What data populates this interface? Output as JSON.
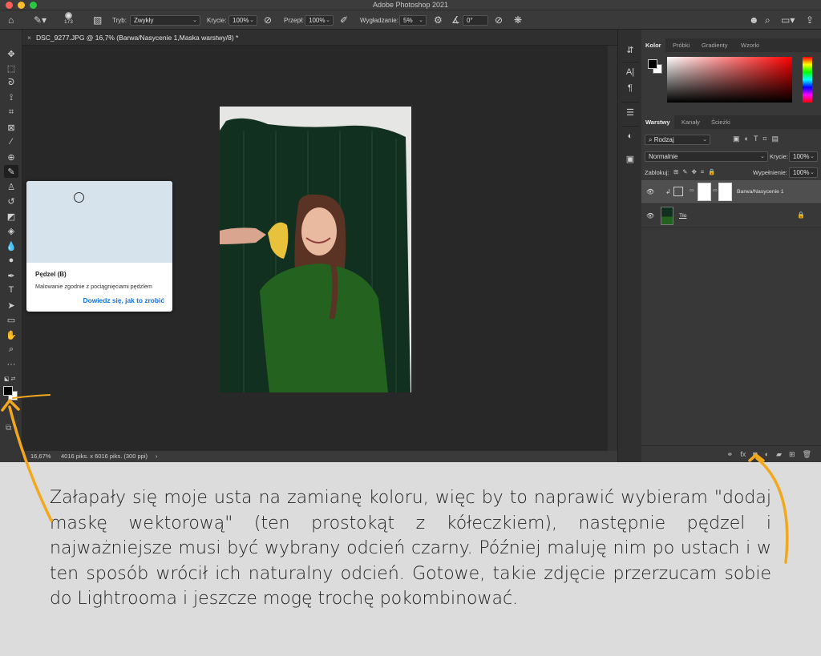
{
  "window": {
    "title": "Adobe Photoshop 2021"
  },
  "options_bar": {
    "brush_size": "173",
    "mode_label": "Tryb:",
    "mode_value": "Zwykły",
    "opacity_label": "Krycie:",
    "opacity_value": "100%",
    "flow_label": "Przepł:",
    "flow_value": "100%",
    "smoothing_label": "Wygładzanie:",
    "smoothing_value": "5%",
    "angle_value": "0°"
  },
  "document": {
    "tab_title": "DSC_9277.JPG @ 16,7% (Barwa/Nasycenie 1,Maska warstwy/8) *",
    "zoom": "16,67%",
    "dimensions": "4016 piks. x 6016 piks. (300 ppi)",
    "status_arrow": "›"
  },
  "tooltip": {
    "title": "Pędzel (B)",
    "description": "Malowanie zgodnie z pociągnięciami pędzlem",
    "link": "Dowiedz się, jak to zrobić"
  },
  "color_panel": {
    "tabs": [
      "Kolor",
      "Próbki",
      "Gradienty",
      "Wzorki"
    ],
    "foreground": "#000000",
    "background": "#ffffff"
  },
  "layers_panel": {
    "tabs": [
      "Warstwy",
      "Kanały",
      "Ścieżki"
    ],
    "filter_label": "Rodzaj",
    "blend_mode": "Normalnie",
    "opacity_label": "Krycie:",
    "opacity_value": "100%",
    "lock_label": "Zablokuj:",
    "fill_label": "Wypełnienie:",
    "fill_value": "100%",
    "layers": [
      {
        "name": "Barwa/Nasycenie 1",
        "selected": true
      },
      {
        "name": "Tło",
        "selected": false
      }
    ]
  },
  "caption": {
    "text": "Załapały się moje usta na zamianę koloru, więc by to naprawić wybieram \"dodaj maskę wektorową\" (ten prostokąt z kółeczkiem), następnie pędzel i najważniejsze musi być wybrany odcień czarny. Później maluję nim po ustach i w ten sposób wrócił ich naturalny odcień.  Gotowe, takie zdjęcie przerzucam sobie do Lightrooma i jeszcze mogę trochę pokombinować."
  },
  "colors": {
    "annotation_arrow": "#f2a81d",
    "ui_dark": "#383838",
    "link_blue": "#1473e6"
  }
}
